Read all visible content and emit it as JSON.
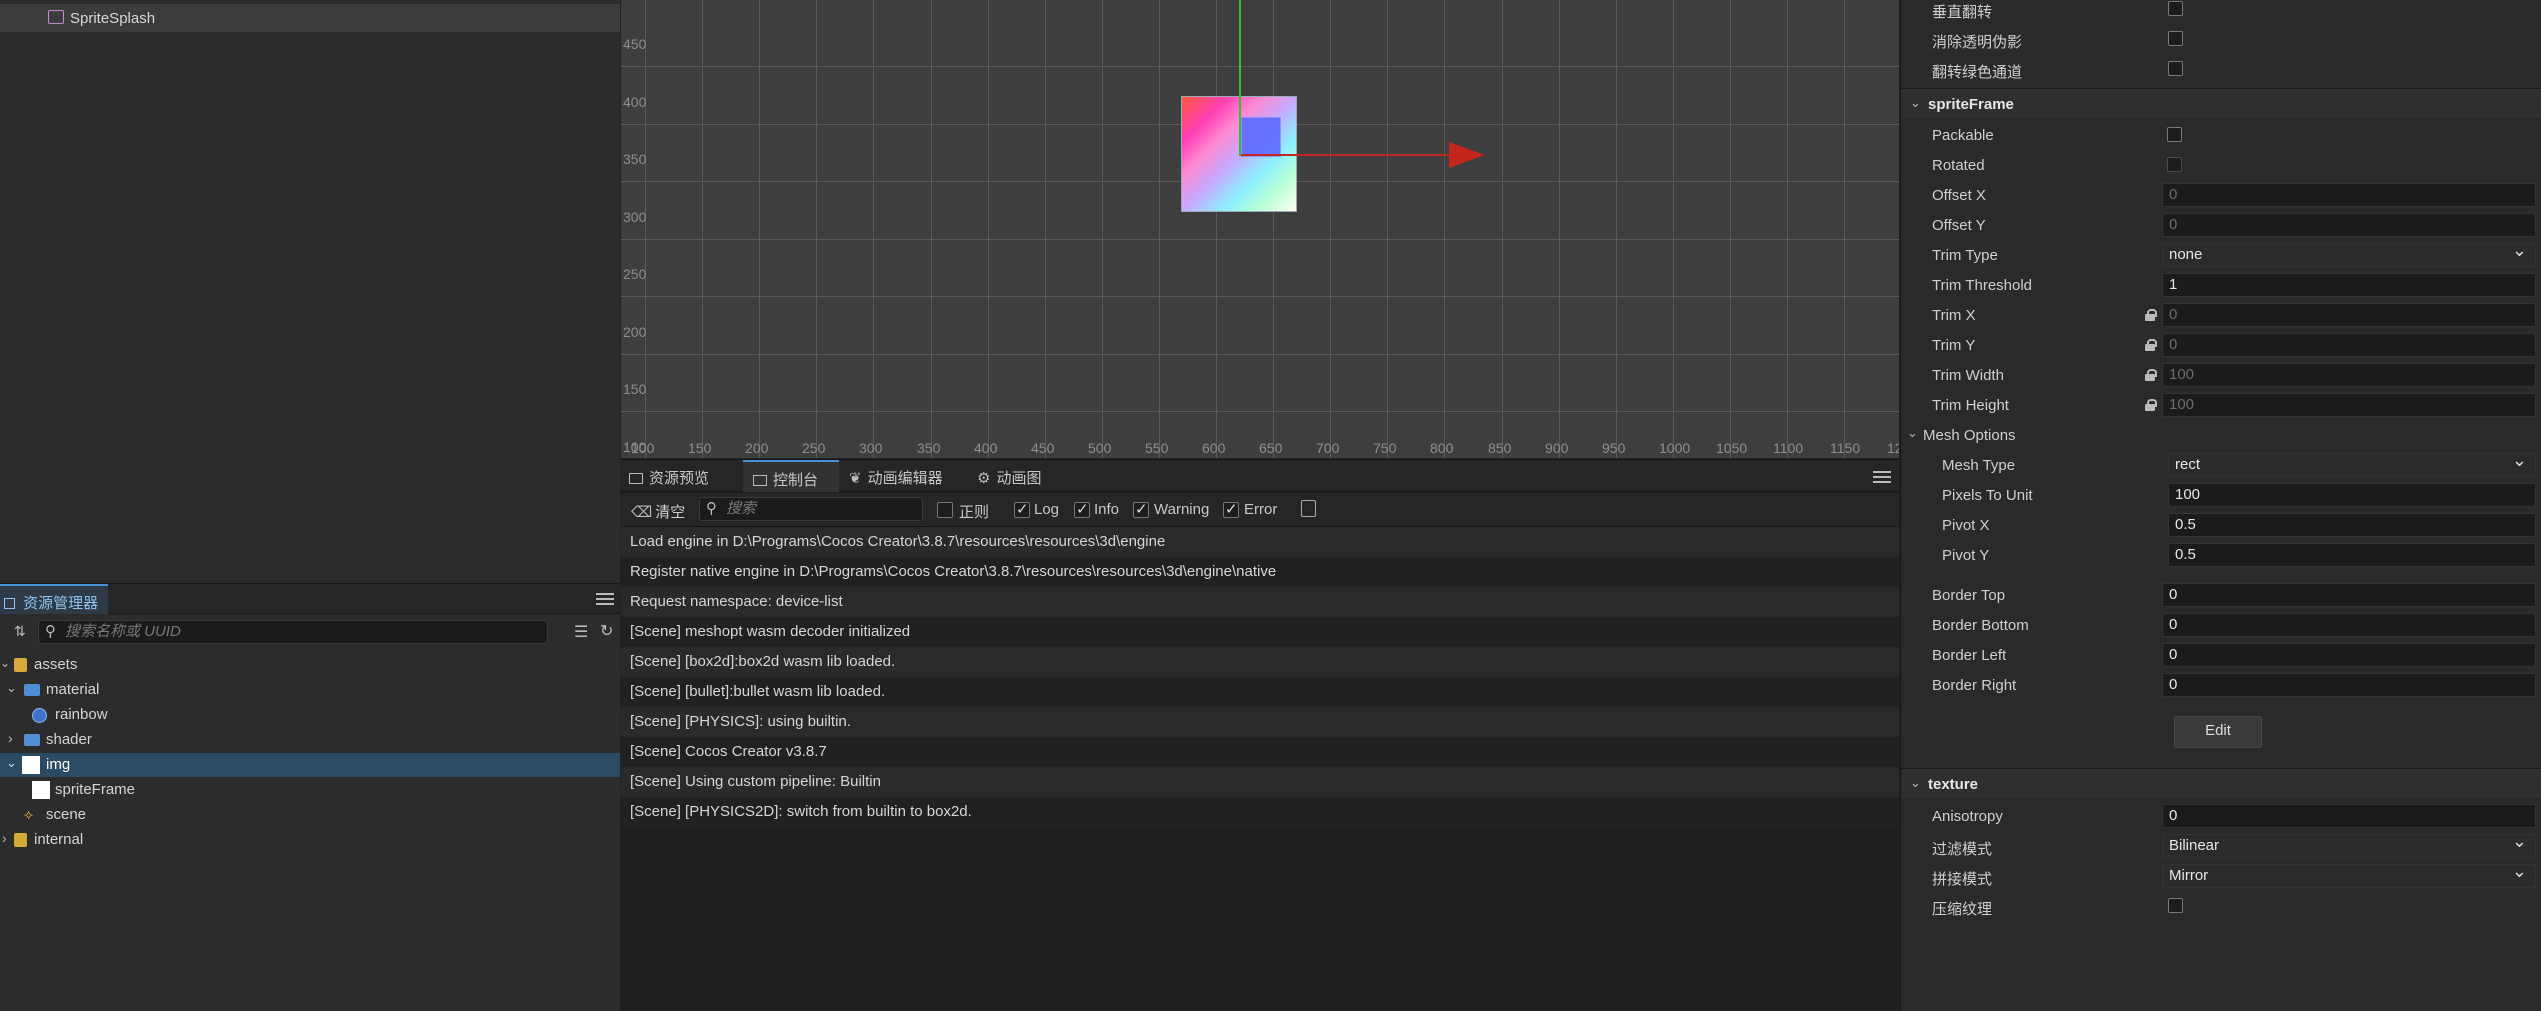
{
  "hierarchy": {
    "node": "SpriteSplash"
  },
  "assets": {
    "tab": "资源管理器",
    "search_placeholder": "搜索名称或 UUID",
    "tree": [
      {
        "label": "assets",
        "icon": "db-icon"
      },
      {
        "label": "material",
        "icon": "folder-open-icon"
      },
      {
        "label": "rainbow",
        "icon": "material-icon"
      },
      {
        "label": "shader",
        "icon": "folder-icon"
      },
      {
        "label": "img",
        "icon": "image-icon"
      },
      {
        "label": "spriteFrame",
        "icon": "sprite-frame-icon"
      },
      {
        "label": "scene",
        "icon": "scene-icon"
      },
      {
        "label": "internal",
        "icon": "db-icon"
      }
    ]
  },
  "scene": {
    "y_labels": [
      "450",
      "400",
      "350",
      "300",
      "250",
      "200",
      "150",
      "100"
    ],
    "x_labels": [
      "100",
      "150",
      "200",
      "250",
      "300",
      "350",
      "400",
      "450",
      "500",
      "550",
      "600",
      "650",
      "700",
      "750",
      "800",
      "850",
      "900",
      "950",
      "1000",
      "1050",
      "1100",
      "1150",
      "12"
    ]
  },
  "console": {
    "tabs": [
      "资源预览",
      "控制台",
      "动画编辑器",
      "动画图"
    ],
    "clear_label": "清空",
    "search_placeholder": "搜索",
    "filters": {
      "regex": "正则",
      "log": "Log",
      "info": "Info",
      "warning": "Warning",
      "error": "Error"
    },
    "logs": [
      "Load engine in D:\\Programs\\Cocos Creator\\3.8.7\\resources\\resources\\3d\\engine",
      "Register native engine in D:\\Programs\\Cocos Creator\\3.8.7\\resources\\resources\\3d\\engine\\native",
      "Request namespace: device-list",
      "[Scene] meshopt wasm decoder initialized",
      "[Scene] [box2d]:box2d wasm lib loaded.",
      "[Scene] [bullet]:bullet wasm lib loaded.",
      "[Scene] [PHYSICS]: using builtin.",
      "[Scene] Cocos Creator v3.8.7",
      "[Scene] Using custom pipeline: Builtin",
      "[Scene] [PHYSICS2D]: switch from builtin to box2d."
    ]
  },
  "inspector": {
    "top_props": [
      "垂直翻转",
      "消除透明伪影",
      "翻转绿色通道"
    ],
    "sprite_frame": {
      "title": "spriteFrame",
      "packable": "Packable",
      "rotated": "Rotated",
      "offset_x": {
        "label": "Offset X",
        "value": "0"
      },
      "offset_y": {
        "label": "Offset Y",
        "value": "0"
      },
      "trim_type": {
        "label": "Trim Type",
        "value": "none"
      },
      "trim_threshold": {
        "label": "Trim Threshold",
        "value": "1"
      },
      "trim_x": {
        "label": "Trim X",
        "value": "0"
      },
      "trim_y": {
        "label": "Trim Y",
        "value": "0"
      },
      "trim_width": {
        "label": "Trim Width",
        "value": "100"
      },
      "trim_height": {
        "label": "Trim Height",
        "value": "100"
      },
      "mesh_options": "Mesh Options",
      "mesh_type": {
        "label": "Mesh Type",
        "value": "rect"
      },
      "pixels_to_unit": {
        "label": "Pixels To Unit",
        "value": "100"
      },
      "pivot_x": {
        "label": "Pivot X",
        "value": "0.5"
      },
      "pivot_y": {
        "label": "Pivot Y",
        "value": "0.5"
      },
      "border_top": {
        "label": "Border Top",
        "value": "0"
      },
      "border_bottom": {
        "label": "Border Bottom",
        "value": "0"
      },
      "border_left": {
        "label": "Border Left",
        "value": "0"
      },
      "border_right": {
        "label": "Border Right",
        "value": "0"
      },
      "edit_label": "Edit"
    },
    "texture": {
      "title": "texture",
      "anisotropy": {
        "label": "Anisotropy",
        "value": "0"
      },
      "filter": {
        "label": "过滤模式",
        "value": "Bilinear"
      },
      "wrap": {
        "label": "拼接模式",
        "value": "Mirror"
      },
      "compress": "压缩纹理"
    }
  },
  "colors": {
    "accent": "#4a90d9",
    "selection": "#2b4a63",
    "gizmo_x": "#c3261c",
    "gizmo_y": "#2fc02f"
  }
}
